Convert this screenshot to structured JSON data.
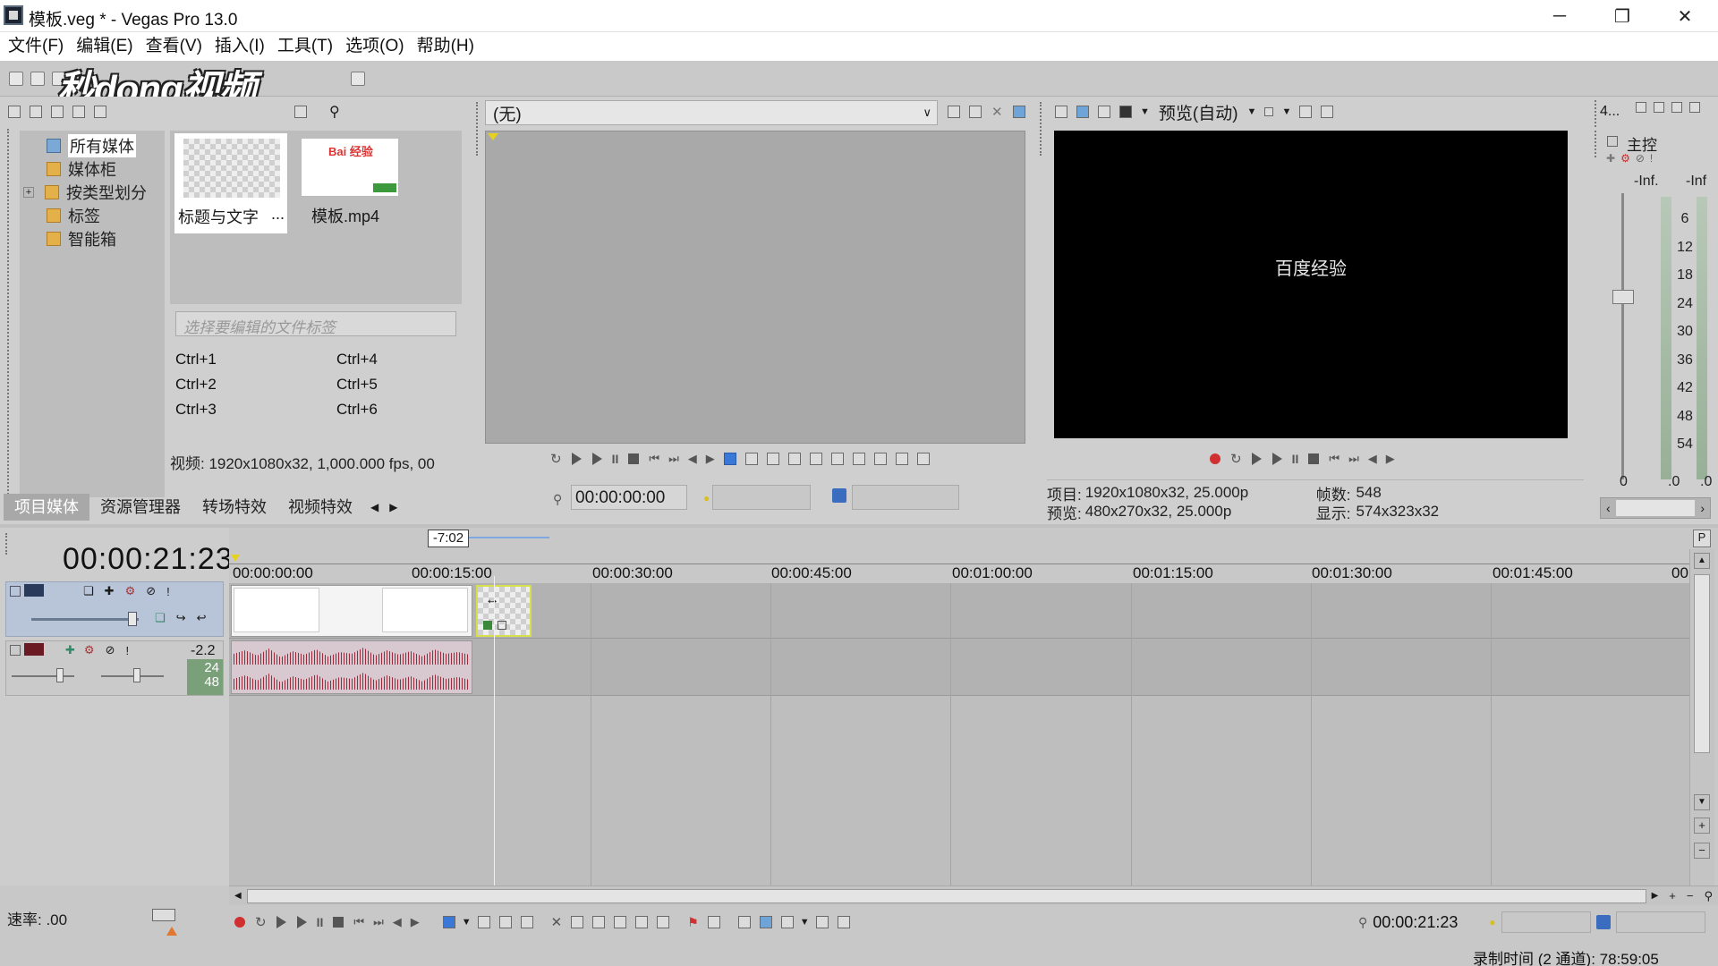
{
  "window": {
    "title": "模板.veg * - Vegas Pro 13.0",
    "minimize_glyph": "─",
    "restore_glyph": "❐",
    "close_glyph": "✕"
  },
  "menu": {
    "items": [
      "文件(F)",
      "编辑(E)",
      "查看(V)",
      "插入(I)",
      "工具(T)",
      "选项(O)",
      "帮助(H)"
    ]
  },
  "watermark": {
    "text": "秒dong视频"
  },
  "explorer": {
    "tree": [
      "所有媒体",
      "媒体柜",
      "按类型划分",
      "标签",
      "智能箱"
    ],
    "media": [
      {
        "label": "标题与文字",
        "ellipsis": "..."
      },
      {
        "label": "模板.mp4",
        "badge": "Bai 经验"
      }
    ],
    "tag_placeholder": "选择要编辑的文件标签",
    "shortcuts": [
      "Ctrl+1",
      "Ctrl+4",
      "Ctrl+2",
      "Ctrl+5",
      "Ctrl+3",
      "Ctrl+6"
    ],
    "info": "视频: 1920x1080x32, 1,000.000 fps, 00",
    "tabs": [
      "项目媒体",
      "资源管理器",
      "转场特效",
      "视频特效"
    ]
  },
  "trimmer": {
    "dropdown_value": "(无)",
    "timecode": "00:00:00:00"
  },
  "preview": {
    "mode_label": "预览(自动)",
    "screen_text": "百度经验",
    "project_label": "项目:",
    "project_value": "1920x1080x32, 25.000p",
    "preview_label": "预览:",
    "preview_value": "480x270x32, 25.000p",
    "frames_label": "帧数:",
    "frames_value": "548",
    "display_label": "显示:",
    "display_value": "574x323x32"
  },
  "master": {
    "title_prefix": "4...",
    "label": "主控",
    "inf_left": "-Inf.",
    "inf_right": "-Inf",
    "scale": [
      "6",
      "12",
      "18",
      "24",
      "30",
      "36",
      "42",
      "48",
      "54"
    ],
    "bottom_left": "0",
    "bottom_mid": ".0",
    "bottom_right": ".0"
  },
  "timeline": {
    "cursor_time": "00:00:21:23",
    "tooltip": "-7:02",
    "ruler": [
      "00:00:00:00",
      "00:00:15:00",
      "00:00:30:00",
      "00:00:45:00",
      "00:01:00:00",
      "00:01:15:00",
      "00:01:30:00",
      "00:01:45:00",
      "00"
    ],
    "audio_db": "-2.2",
    "audio_meter_top": "24",
    "audio_meter_bottom": "48",
    "rate_label": "速率: .00",
    "bottom_timecode": "00:00:21:23",
    "record_time": "录制时间 (2 通道): 78:59:05",
    "marker_p": "P"
  },
  "colors": {
    "accent_blue": "#3a78d8",
    "clip_selected": "#d6e04a",
    "waveform": "#9e2a3c"
  }
}
